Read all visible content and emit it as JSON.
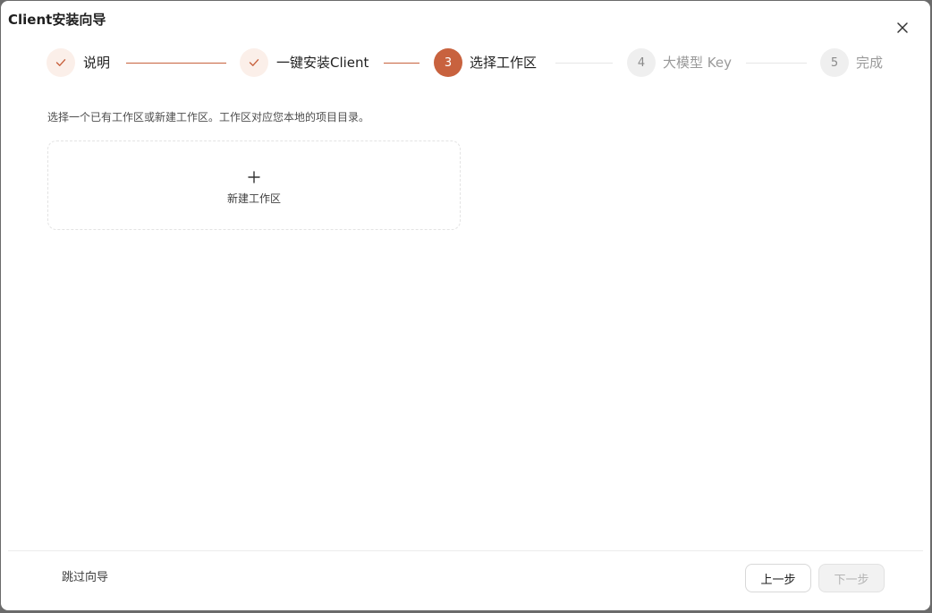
{
  "window": {
    "title": "Client安装向导"
  },
  "steps": [
    {
      "number": "1",
      "label": "说明",
      "state": "done"
    },
    {
      "number": "2",
      "label": "一键安装Client",
      "state": "done"
    },
    {
      "number": "3",
      "label": "选择工作区",
      "state": "active"
    },
    {
      "number": "4",
      "label": "大模型 Key",
      "state": "pending"
    },
    {
      "number": "5",
      "label": "完成",
      "state": "pending"
    }
  ],
  "main": {
    "description": "选择一个已有工作区或新建工作区。工作区对应您本地的项目目录。",
    "new_workspace_label": "新建工作区"
  },
  "footer": {
    "skip_label": "跳过向导",
    "prev_label": "上一步",
    "next_label": "下一步"
  },
  "colors": {
    "accent": "#c8623e",
    "done_circle_bg": "#fbefe9",
    "pending_circle_bg": "#efefef"
  },
  "icons": {
    "close": "close-icon",
    "check": "check-icon",
    "plus": "plus-icon"
  }
}
